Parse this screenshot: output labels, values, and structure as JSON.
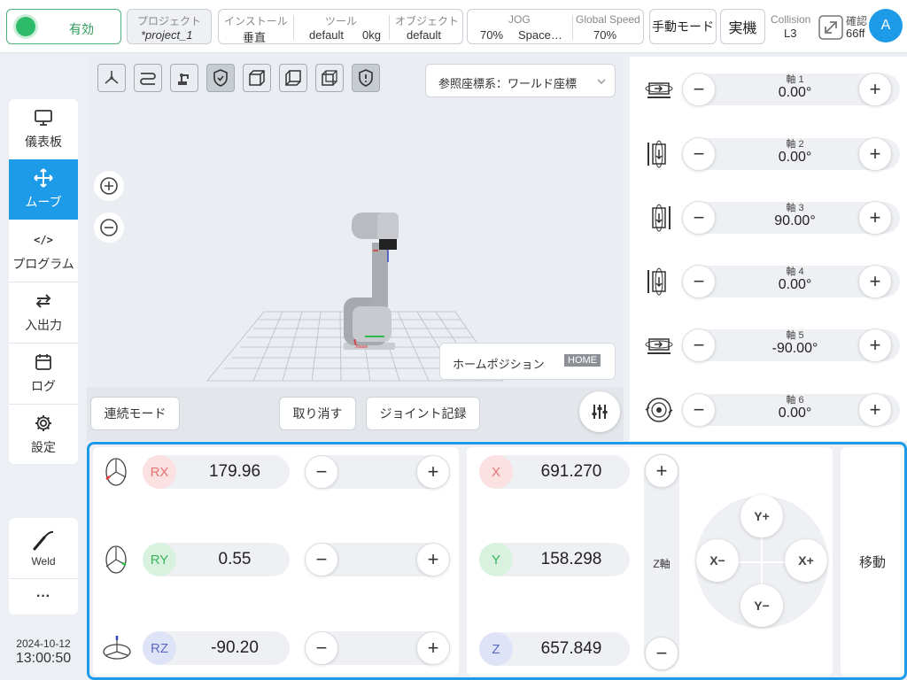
{
  "topbar": {
    "status_label": "有効",
    "project_label": "プロジェクト",
    "project_value": "*project_1",
    "install_label": "インストール",
    "install_value": "垂直",
    "tool_label": "ツール",
    "tool_value": "default",
    "tool_weight": "0kg",
    "object_label": "オブジェクト",
    "object_value": "default",
    "jog_label": "JOG",
    "jog_value": "70%",
    "space_value": "Space…",
    "global_speed_label": "Global Speed",
    "global_speed_value": "70%",
    "manual_mode": "手動モード",
    "real_machine": "実機",
    "collision_label": "Collision",
    "collision_value": "L3",
    "confirm_label": "確認",
    "confirm_value": "66ff",
    "avatar": "A"
  },
  "sidebar": {
    "items": [
      {
        "label": "儀表板",
        "icon": "monitor-icon"
      },
      {
        "label": "ムーブ",
        "icon": "move-arrows-icon"
      },
      {
        "label": "プログラム",
        "icon": "code-icon"
      },
      {
        "label": "入出力",
        "icon": "swap-icon"
      },
      {
        "label": "ログ",
        "icon": "calendar-icon"
      },
      {
        "label": "設定",
        "icon": "gear-icon"
      }
    ],
    "weld_label": "Weld",
    "more_label": "···",
    "date": "2024-10-12",
    "time": "13:00:50"
  },
  "viewport": {
    "ref_frame": "参照座標系：ワールド座標",
    "home_position": "ホームポジション",
    "home_badge": "HOME",
    "continuous_mode": "連続モード",
    "undo": "取り消す",
    "joint_record": "ジョイント記録",
    "axis_label": "Xbase"
  },
  "joints": [
    {
      "label": "軸 1",
      "value": "0.00°"
    },
    {
      "label": "軸 2",
      "value": "0.00°"
    },
    {
      "label": "軸 3",
      "value": "90.00°"
    },
    {
      "label": "軸 4",
      "value": "0.00°"
    },
    {
      "label": "軸 5",
      "value": "-90.00°"
    },
    {
      "label": "軸 6",
      "value": "0.00°"
    }
  ],
  "rotation": [
    {
      "axis": "RX",
      "value": "179.96",
      "color": "#e57373",
      "bg": "#fbe1e1"
    },
    {
      "axis": "RY",
      "value": "0.55",
      "color": "#3bb35f",
      "bg": "#d9f2df"
    },
    {
      "axis": "RZ",
      "value": "-90.20",
      "color": "#5c6bc0",
      "bg": "#dfe3f7"
    }
  ],
  "translation": [
    {
      "axis": "X",
      "value": "691.270",
      "color": "#e57373",
      "bg": "#fbe1e1"
    },
    {
      "axis": "Y",
      "value": "158.298",
      "color": "#3bb35f",
      "bg": "#d9f2df"
    },
    {
      "axis": "Z",
      "value": "657.849",
      "color": "#5c6bc0",
      "bg": "#dfe3f7"
    }
  ],
  "zaxis_label": "Z軸",
  "dpad": {
    "up": "Y+",
    "down": "Y−",
    "left": "X−",
    "right": "X+"
  },
  "move_label": "移動",
  "minus": "−",
  "plus": "+"
}
